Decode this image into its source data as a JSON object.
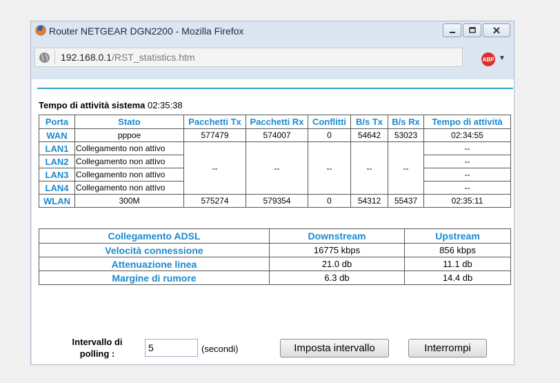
{
  "window": {
    "title": "Router NETGEAR DGN2200 - Mozilla Firefox",
    "url_host": "192.168.0.1",
    "url_path": "/RST_statistics.htm",
    "adblock_label": "ABP"
  },
  "uptime": {
    "label": "Tempo di attività sistema",
    "value": "02:35:38"
  },
  "stats": {
    "headers": [
      "Porta",
      "Stato",
      "Pacchetti Tx",
      "Pacchetti Rx",
      "Conflitti",
      "B/s Tx",
      "B/s Rx",
      "Tempo di attività"
    ],
    "wan": {
      "port": "WAN",
      "status": "pppoe",
      "tx": "577479",
      "rx": "574007",
      "collisions": "0",
      "bps_tx": "54642",
      "bps_rx": "53023",
      "uptime": "02:34:55"
    },
    "lan": [
      {
        "port": "LAN1",
        "status": "Collegamento non attivo",
        "uptime": "--"
      },
      {
        "port": "LAN2",
        "status": "Collegamento non attivo",
        "uptime": "--"
      },
      {
        "port": "LAN3",
        "status": "Collegamento non attivo",
        "uptime": "--"
      },
      {
        "port": "LAN4",
        "status": "Collegamento non attivo",
        "uptime": "--"
      }
    ],
    "lan_shared": {
      "tx": "--",
      "rx": "--",
      "collisions": "--",
      "bps_tx": "--",
      "bps_rx": "--"
    },
    "wlan": {
      "port": "WLAN",
      "status": "300M",
      "tx": "575274",
      "rx": "579354",
      "collisions": "0",
      "bps_tx": "54312",
      "bps_rx": "55437",
      "uptime": "02:35:11"
    }
  },
  "adsl": {
    "headers": [
      "Collegamento ADSL",
      "Downstream",
      "Upstream"
    ],
    "rows": [
      {
        "label": "Velocità connessione",
        "down": "16775 kbps",
        "up": "856 kbps"
      },
      {
        "label": "Attenuazione linea",
        "down": "21.0 db",
        "up": "11.1 db"
      },
      {
        "label": "Margine di rumore",
        "down": "6.3 db",
        "up": "14.4 db"
      }
    ]
  },
  "polling": {
    "label_line1": "Intervallo di",
    "label_line2": "polling :",
    "value": "5",
    "unit": "(secondi)",
    "set_button": "Imposta intervallo",
    "stop_button": "Interrompi"
  }
}
